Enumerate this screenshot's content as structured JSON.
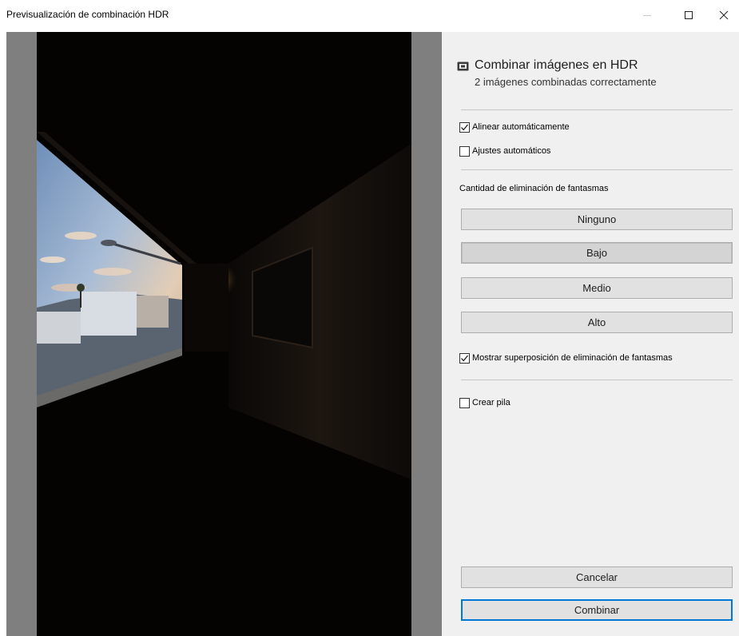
{
  "window": {
    "title": "Previsualización de combinación HDR",
    "controls": {
      "minimize_icon": "minimize-icon",
      "maximize_icon": "maximize-icon",
      "close_icon": "close-icon"
    }
  },
  "preview": {
    "description_icon": "photo-preview"
  },
  "panel": {
    "header": {
      "icon": "hdr-merge-icon",
      "title": "Combinar imágenes en HDR",
      "subtitle": "2 imágenes combinadas correctamente"
    },
    "options": {
      "auto_align": {
        "label": "Alinear automáticamente",
        "checked": true
      },
      "auto_settings": {
        "label": "Ajustes automáticos",
        "checked": false
      }
    },
    "deghost": {
      "label": "Cantidad de eliminación de fantasmas",
      "levels": [
        "Ninguno",
        "Bajo",
        "Medio",
        "Alto"
      ],
      "selected": "Bajo",
      "show_overlay": {
        "label": "Mostrar superposición de eliminación de fantasmas",
        "checked": true
      }
    },
    "stack": {
      "label": "Crear pila",
      "checked": false
    },
    "buttons": {
      "cancel": "Cancelar",
      "merge": "Combinar"
    }
  }
}
